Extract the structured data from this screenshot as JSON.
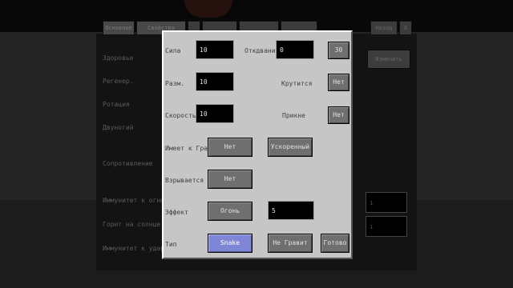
{
  "background": {
    "tabs": [
      "Основное",
      "Свойства",
      "",
      "",
      "",
      "",
      "Назад",
      "X"
    ],
    "labels": [
      "Здоровье",
      "Регенер.",
      "Ротация",
      "Двуногий",
      "Сопротивление",
      "Иммунитет к огню",
      "Горит на солнце",
      "Иммунитет к удар."
    ],
    "right_button": "Изменить",
    "right_fields": [
      "1",
      "1"
    ]
  },
  "dialog": {
    "labels": {
      "strength": "Сила",
      "cooldown": "Откдвание",
      "range": "Разм.",
      "rotate": "Крутится",
      "speed": "Скорость",
      "explode": "Прикне",
      "gravity": "Имеет к Гравит",
      "exploding": "Взрывается",
      "effect": "Эффект",
      "type": "Тип"
    },
    "fields": {
      "strength": "10",
      "cooldown": "0",
      "range": "10",
      "speed": "10",
      "effect_value": "5"
    },
    "buttons": {
      "sound": "30",
      "rotate": "Нет",
      "explode": "Нет",
      "gravity": "Нет",
      "accelerates": "Ускоренный",
      "exploding": "Нет",
      "effect": "Огонь",
      "type": "Snake",
      "no_gravity": "Не Гравит",
      "done": "Готово"
    }
  },
  "colors": {
    "selected_button": "#7f86d6",
    "dialog_bg": "#c6c6c6"
  }
}
